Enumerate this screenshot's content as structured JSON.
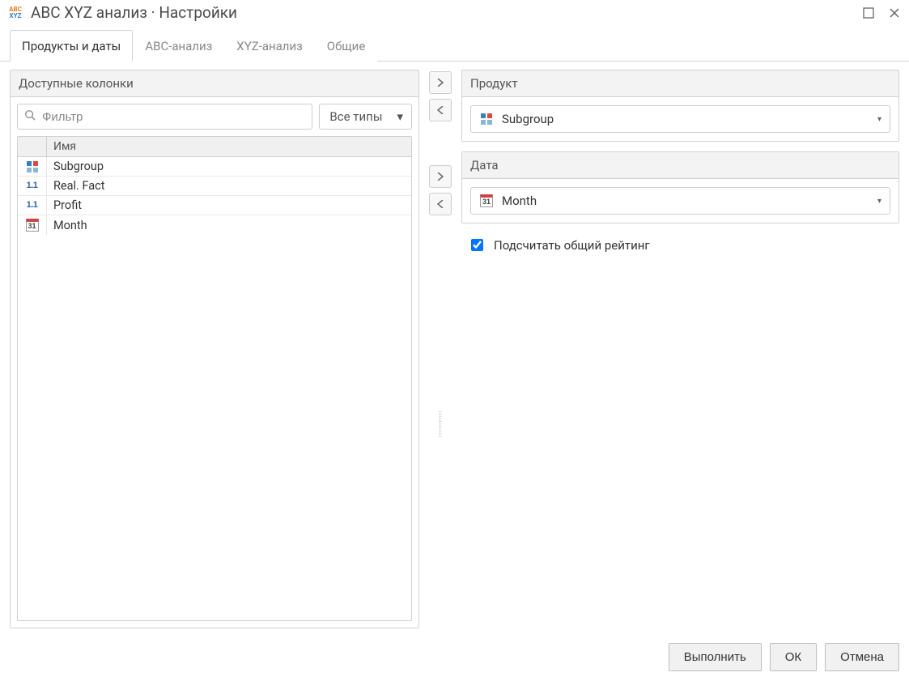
{
  "window": {
    "title": "ABC XYZ анализ · Настройки"
  },
  "tabs": [
    {
      "label": "Продукты и даты",
      "active": true
    },
    {
      "label": "ABC-анализ",
      "active": false
    },
    {
      "label": "XYZ-анализ",
      "active": false
    },
    {
      "label": "Общие",
      "active": false
    }
  ],
  "left_panel": {
    "header": "Доступные колонки",
    "filter_placeholder": "Фильтр",
    "type_select": "Все типы",
    "table_header": "Имя",
    "rows": [
      {
        "icon": "squares",
        "name": "Subgroup"
      },
      {
        "icon": "number",
        "name": "Real. Fact"
      },
      {
        "icon": "number",
        "name": "Profit"
      },
      {
        "icon": "calendar",
        "name": "Month"
      }
    ]
  },
  "right": {
    "product": {
      "header": "Продукт",
      "value": "Subgroup",
      "icon": "squares"
    },
    "date": {
      "header": "Дата",
      "value": "Month",
      "icon": "calendar"
    },
    "checkbox": {
      "label": "Подсчитать общий рейтинг",
      "checked": true
    }
  },
  "footer": {
    "run": "Выполнить",
    "ok": "ОК",
    "cancel": "Отмена"
  },
  "icons": {
    "calendar_day": "31"
  }
}
